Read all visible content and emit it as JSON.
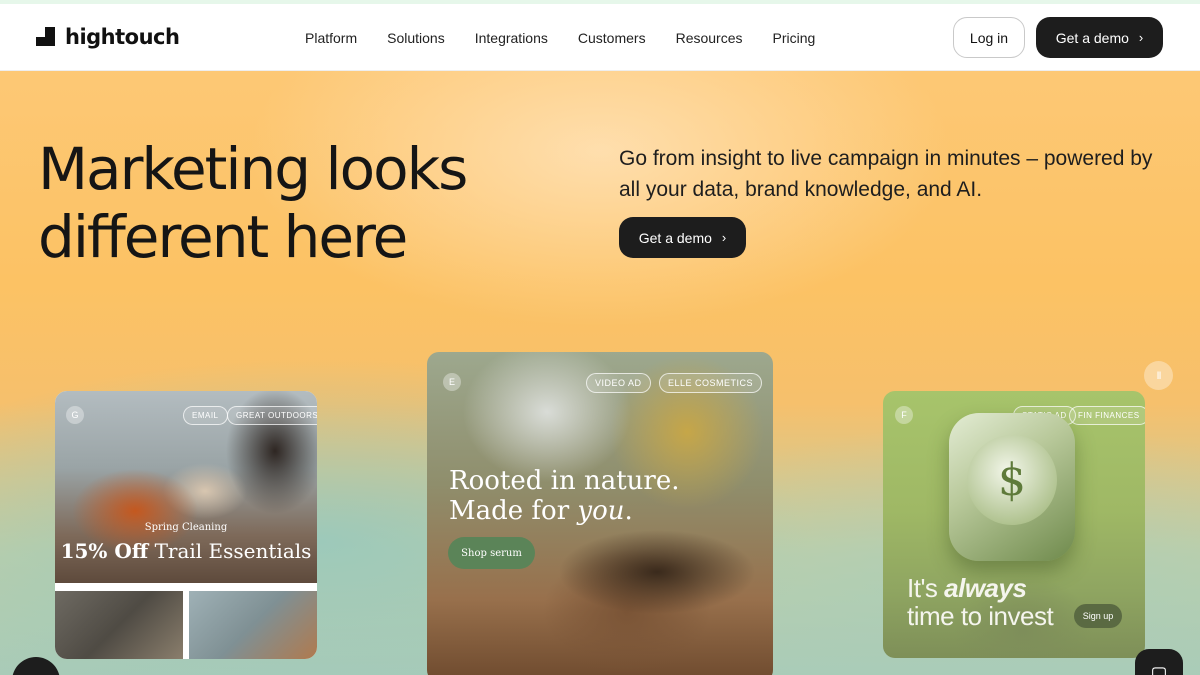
{
  "brand": {
    "name": "hightouch"
  },
  "nav": {
    "items": [
      {
        "label": "Platform"
      },
      {
        "label": "Solutions"
      },
      {
        "label": "Integrations"
      },
      {
        "label": "Customers"
      },
      {
        "label": "Resources"
      },
      {
        "label": "Pricing"
      }
    ],
    "login_label": "Log in",
    "demo_label": "Get a demo"
  },
  "hero": {
    "headline_line1": "Marketing looks",
    "headline_line2": "different here",
    "subhead": "Go from insight to live campaign in minutes – powered by all your data, brand knowledge, and AI.",
    "cta_label": "Get a demo"
  },
  "cards": {
    "left": {
      "avatar": "G",
      "tags": [
        "EMAIL",
        "GREAT OUTDOORS"
      ],
      "small_text": "Spring Cleaning",
      "big_bold": "15% Off",
      "big_rest": " Trail Essentials"
    },
    "center": {
      "avatar": "E",
      "tags": [
        "VIDEO AD",
        "ELLE COSMETICS"
      ],
      "line1": "Rooted in nature.",
      "line2_prefix": "Made for ",
      "line2_italic": "you",
      "line2_suffix": ".",
      "button_label": "Shop serum"
    },
    "right": {
      "avatar": "F",
      "tags": [
        "STATIC AD",
        "FIN FINANCES"
      ],
      "line1_prefix": "It's ",
      "line1_italic": "always",
      "line2": "time to invest",
      "button_label": "Sign up",
      "clock_symbol": "$"
    }
  },
  "icons": {
    "chevron": "›",
    "pause": "II"
  },
  "colors": {
    "accent_dark": "#1d1d1d",
    "hero_orange": "#fcc264",
    "hero_teal": "#a9cbb8"
  }
}
